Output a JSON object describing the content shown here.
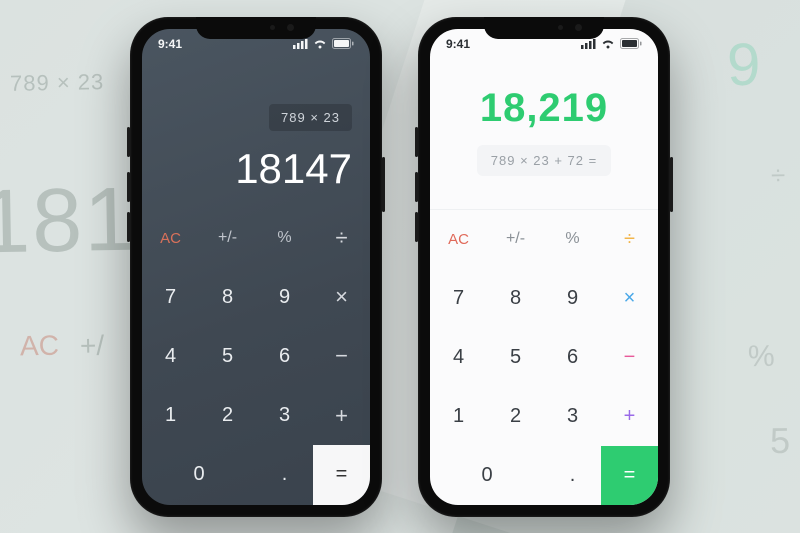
{
  "status": {
    "time": "9:41"
  },
  "calculators": {
    "dark": {
      "expression": "789 × 23",
      "result": "18147"
    },
    "light": {
      "expression": "789 × 23 + 72 =",
      "result": "18,219"
    }
  },
  "keys": {
    "ac": "AC",
    "sign": "+/-",
    "percent": "%",
    "divide": "÷",
    "seven": "7",
    "eight": "8",
    "nine": "9",
    "multiply": "×",
    "four": "4",
    "five": "5",
    "six": "6",
    "subtract": "−",
    "one": "1",
    "two": "2",
    "three": "3",
    "add": "+",
    "zero": "0",
    "decimal": ".",
    "equals": "="
  },
  "ghost": {
    "g1": "789 × 23",
    "g2": "181",
    "g3": "AC",
    "g4": "+/",
    "g5": "9",
    "g6": "÷",
    "g7": "%",
    "g8": "5"
  }
}
